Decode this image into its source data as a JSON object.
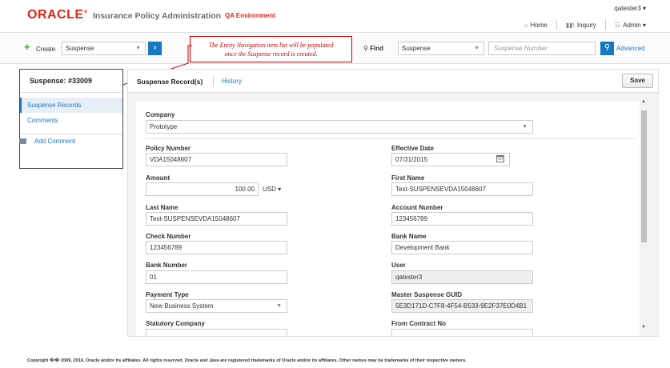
{
  "header": {
    "logo": "ORACLE",
    "app_title": "Insurance Policy Administration",
    "environment": "QA Environment",
    "user": "qatester3 ▾",
    "nav": [
      {
        "label": "Home",
        "icon": "home-icon"
      },
      {
        "label": "Inquiry",
        "icon": "inquiry-icon"
      },
      {
        "label": "Admin ▾",
        "icon": "admin-icon"
      }
    ]
  },
  "toolbar": {
    "create_label": "Create",
    "create_select": "Suspense",
    "find_label": "Find",
    "find_select": "Suspense",
    "find_placeholder": "Suspense Number",
    "advanced": "Advanced"
  },
  "annotation": {
    "line1": "The Entity Navigation item list will be populated",
    "line2": "once the Suspense record is created."
  },
  "left_panel": {
    "title": "Suspense: #33009",
    "items": [
      "Suspense Records",
      "Comments"
    ],
    "add_comment": "Add Comment"
  },
  "tabs": {
    "active": "Suspense Record(s)",
    "other": "History",
    "save": "Save"
  },
  "form": {
    "company_label": "Company",
    "company_value": "Prototype",
    "policy_number_label": "Policy Number",
    "policy_number_value": "VDA15048607",
    "effective_date_label": "Effective Date",
    "effective_date_value": "07/31/2015",
    "amount_label": "Amount",
    "amount_value": "100.00",
    "currency_value": "USD ▾",
    "first_name_label": "First Name",
    "first_name_value": "Test-SUSPENSEVDA15048607",
    "last_name_label": "Last Name",
    "last_name_value": "Test-SUSPENSEVDA15048607",
    "account_number_label": "Account Number",
    "account_number_value": "123456789",
    "check_number_label": "Check Number",
    "check_number_value": "123456789",
    "bank_name_label": "Bank Name",
    "bank_name_value": "Development Bank",
    "bank_number_label": "Bank Number",
    "bank_number_value": "01",
    "user_label": "User",
    "user_value": "qatester3",
    "payment_type_label": "Payment Type",
    "payment_type_value": "New Business System",
    "master_guid_label": "Master Suspense GUID",
    "master_guid_value": "5E3D171D-C7F8-4F54-B533-9E2F37E0D4B1",
    "statutory_company_label": "Statutory Company",
    "from_contract_label": "From Contract No"
  },
  "footer": "Copyright �� 2009, 2016, Oracle and/or its affiliates. All rights reserved. Oracle and Java are registered trademarks of Oracle and/or its affiliates. Other names may be trademarks of their respective owners.",
  "colors": {
    "brand_red": "#e2231a",
    "link_blue": "#1a78c2",
    "annotation_red": "#cc0000"
  }
}
